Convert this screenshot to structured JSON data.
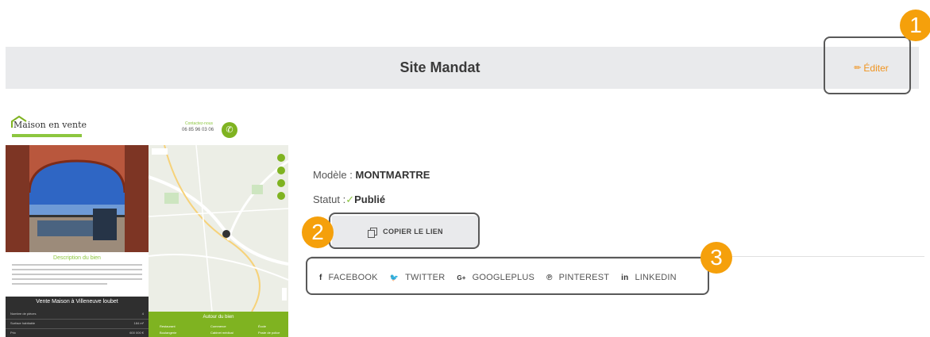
{
  "header": {
    "title": "Site Mandat",
    "edit_label": "Éditer"
  },
  "callouts": [
    "1",
    "2",
    "3"
  ],
  "preview": {
    "logo_text": "Maison en vente",
    "phone_label": "Contactez-nous",
    "phone_number": "06 85 96 03 06",
    "description_title": "Description du bien",
    "details_title": "Vente Maison à Villeneuve loubet",
    "details_rows": [
      {
        "label": "Nombre de pièces",
        "value": "4"
      },
      {
        "label": "Surface habitable",
        "value": "184 m²"
      },
      {
        "label": "Prix",
        "value": "600 000 €"
      }
    ],
    "around_title": "Autour du bien",
    "around_items": [
      "Restaurant",
      "Commerce",
      "École",
      "Boulangerie",
      "Cabinet médical",
      "Poste de police"
    ]
  },
  "info": {
    "model_label": "Modèle :",
    "model_value": "MONTMARTRE",
    "status_label": "Statut :",
    "status_value": "Publié"
  },
  "copy_button": {
    "label": "COPIER LE LIEN",
    "icon": "copy-icon"
  },
  "social": [
    {
      "icon": "facebook-icon",
      "glyph": "f",
      "label": "FACEBOOK"
    },
    {
      "icon": "twitter-icon",
      "glyph": "🐦",
      "label": "TWITTER"
    },
    {
      "icon": "googleplus-icon",
      "glyph": "G+",
      "label": "GOOGLEPLUS"
    },
    {
      "icon": "pinterest-icon",
      "glyph": "℗",
      "label": "PINTEREST"
    },
    {
      "icon": "linkedin-icon",
      "glyph": "in",
      "label": "LINKEDIN"
    }
  ],
  "colors": {
    "accent_orange": "#f5a00b",
    "edit_orange": "#f0941f",
    "brand_green": "#8cc63f",
    "header_bg": "#e9eaec"
  }
}
